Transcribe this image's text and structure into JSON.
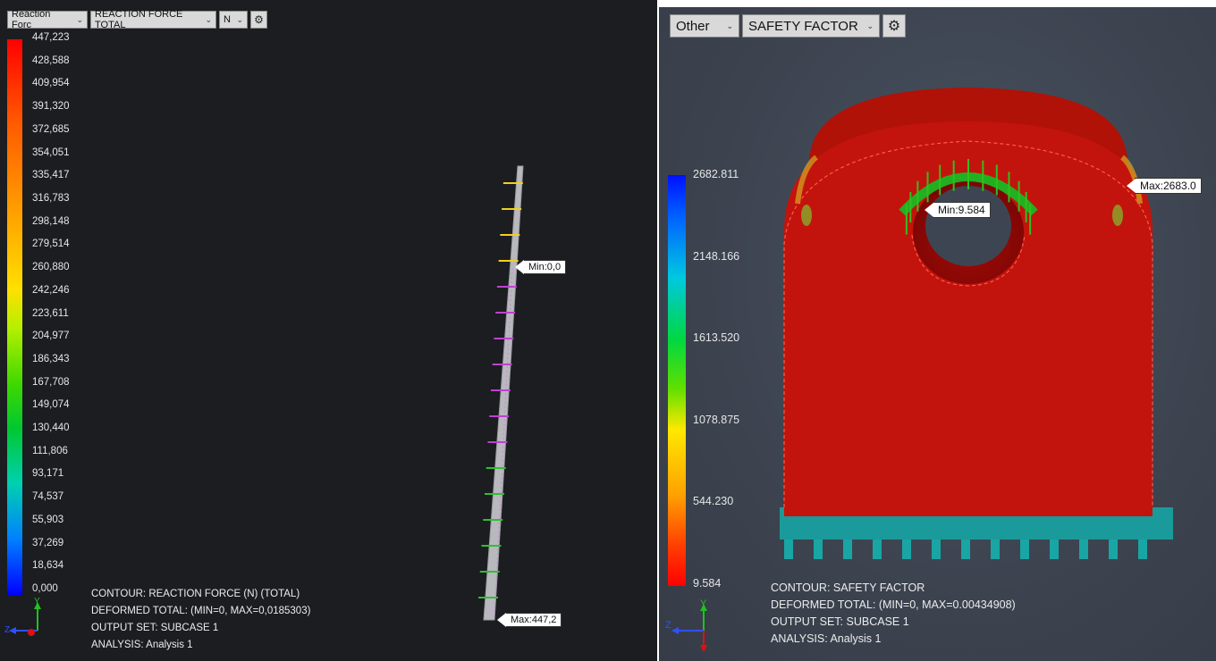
{
  "left": {
    "toolbar": {
      "category": "Reaction Forc",
      "result": "REACTION FORCE TOTAL",
      "unit": "N",
      "settings_icon": "gear-icon"
    },
    "legend": {
      "ticks": [
        "447,223",
        "428,588",
        "409,954",
        "391,320",
        "372,685",
        "354,051",
        "335,417",
        "316,783",
        "298,148",
        "279,514",
        "260,880",
        "242,246",
        "223,611",
        "204,977",
        "186,343",
        "167,708",
        "149,074",
        "130,440",
        "111,806",
        "93,171",
        "74,537",
        "55,903",
        "37,269",
        "18,634",
        "0,000"
      ]
    },
    "info": {
      "line1": "CONTOUR: REACTION FORCE (N) (TOTAL)",
      "line2": "DEFORMED TOTAL: (MIN=0, MAX=0,0185303)",
      "line3": "OUTPUT SET: SUBCASE 1",
      "line4": "ANALYSIS: Analysis 1"
    },
    "labels": {
      "min": "Min:0,0",
      "max": "Max:447,2"
    },
    "triad": {
      "y": "Y",
      "z": "Z"
    }
  },
  "right": {
    "toolbar": {
      "category": "Other",
      "result": "SAFETY FACTOR",
      "settings_icon": "gear-icon"
    },
    "legend": {
      "ticks": [
        "2682.811",
        "2148.166",
        "1613.520",
        "1078.875",
        "544.230",
        "9.584"
      ]
    },
    "info": {
      "line1": "CONTOUR: SAFETY FACTOR",
      "line2": "DEFORMED TOTAL: (MIN=0, MAX=0.00434908)",
      "line3": "OUTPUT SET: SUBCASE 1",
      "line4": "ANALYSIS: Analysis 1"
    },
    "labels": {
      "min": "Min:9.584",
      "max": "Max:2683.0"
    },
    "triad": {
      "y": "Y",
      "z": "Z"
    }
  },
  "colors": {
    "high": "#ff0000",
    "low": "#0000ff",
    "part": "#c2140c",
    "constraint": "#1aa5a5"
  }
}
